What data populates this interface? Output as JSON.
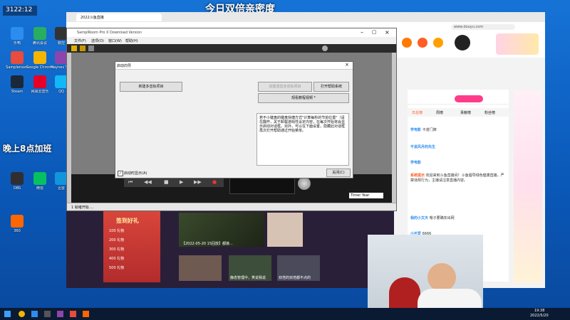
{
  "colors": {
    "accent": "#1a73e8",
    "chat_pink": "#ff3c8a",
    "taskbar": "#0a1a33",
    "sr_dark": "#2b2b2b"
  },
  "overlays": {
    "top_title": "今日双倍亲密度",
    "left_banner": "晚上8点加班",
    "clock_widget": "3122:12"
  },
  "desktop_icons": [
    {
      "label": "乐鸭",
      "color": "#2d8cf0"
    },
    {
      "label": "腾讯会议",
      "color": "#27ae60"
    },
    {
      "label": "数控",
      "color": "#333"
    },
    {
      "label": "Sampleroom",
      "color": "#e74c3c"
    },
    {
      "label": "Google Chrome",
      "color": "#f4b400"
    },
    {
      "label": "Maynes Tool",
      "color": "#8e44ad"
    },
    {
      "label": "Steam",
      "color": "#1b2838"
    },
    {
      "label": "网易云音乐",
      "color": "#e60026"
    },
    {
      "label": "QQ",
      "color": "#12b7f5"
    },
    {
      "label": "OBS",
      "color": "#302e31"
    },
    {
      "label": "微信",
      "color": "#07c160"
    },
    {
      "label": "迅雷",
      "color": "#1296db"
    },
    {
      "label": "360",
      "color": "#ff6600"
    }
  ],
  "browser": {
    "tab_label": "2022斗鱼直播",
    "address": "www.douyu.com",
    "chat_tabs": [
      "日总榜",
      "周榜",
      "贡献榜",
      "粉丝榜"
    ],
    "chat_messages": [
      {
        "user": "学电影",
        "text": "卡诺门牌"
      },
      {
        "user": "不说风月的先生",
        "text": ""
      },
      {
        "user": "学电影",
        "text": ""
      },
      {
        "user": "系统提示",
        "text": "欢迎来到斗鱼直播间！斗鱼倡导绿色健康直播，严禁违规行为，主播请注意直播内容。"
      },
      {
        "user": "我的小文天",
        "text": "嗯子要确实出网"
      },
      {
        "user": "小可爱",
        "text": "6666"
      }
    ],
    "stream_thumb_captions": [
      "【2022-05-20 15回放】都接...",
      "静态管理中，笑说我说",
      "双倍的双倍都不点的"
    ],
    "promo_title": "签到好礼",
    "promo_items": [
      "100 礼物",
      "200 礼物",
      "300 礼物",
      "400 礼物",
      "500 礼物"
    ]
  },
  "sampleroom": {
    "title": "SamplRoom Pro X Download Version",
    "menu": [
      "文件(F)",
      "选项(O)",
      "窗口(W)",
      "帮助(H)"
    ],
    "status": "1 就绪开始 ...",
    "transport_mode": "Timer Year"
  },
  "dialog": {
    "title": "启动向导",
    "new_project": "新建多音轨项目",
    "create_session": "创建混音多音轨项目",
    "open_help": "打开帮助系统",
    "tutorial": "观看教程视频 *",
    "description": "若不小键盘的键盘快捷方式\"计算每秒的节拍位置\"（请在翻开，关于卸载游戏性设定内容，在每次开始将会显示启动对话框。另外，可以在下面设置，隐藏此对话框再次打开帮助通过开始菜单。",
    "checkbox_label": "启动时显示(A)",
    "close": "关闭(C)"
  },
  "taskbar": {
    "time": "19:38",
    "date": "2022/5/20"
  }
}
